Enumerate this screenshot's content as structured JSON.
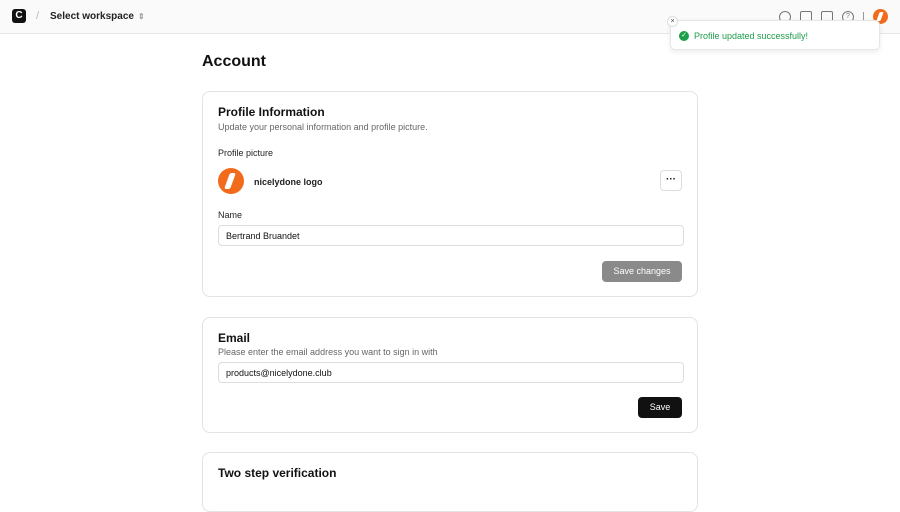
{
  "topbar": {
    "logo": "C",
    "workspace": "Select workspace"
  },
  "toast": {
    "message": "Profile updated successfully!",
    "close": "×",
    "check": "✓"
  },
  "page_title": "Account",
  "profile": {
    "title": "Profile Information",
    "subtitle": "Update your personal information and profile picture.",
    "picture_label": "Profile picture",
    "picture_name": "nicelydone logo",
    "more": "···",
    "name_label": "Name",
    "name_value": "Bertrand Bruandet",
    "save": "Save changes"
  },
  "email": {
    "title": "Email",
    "subtitle": "Please enter the email address you want to sign in with",
    "value": "products@nicelydone.club",
    "save": "Save"
  },
  "two_step": {
    "title": "Two step verification"
  }
}
